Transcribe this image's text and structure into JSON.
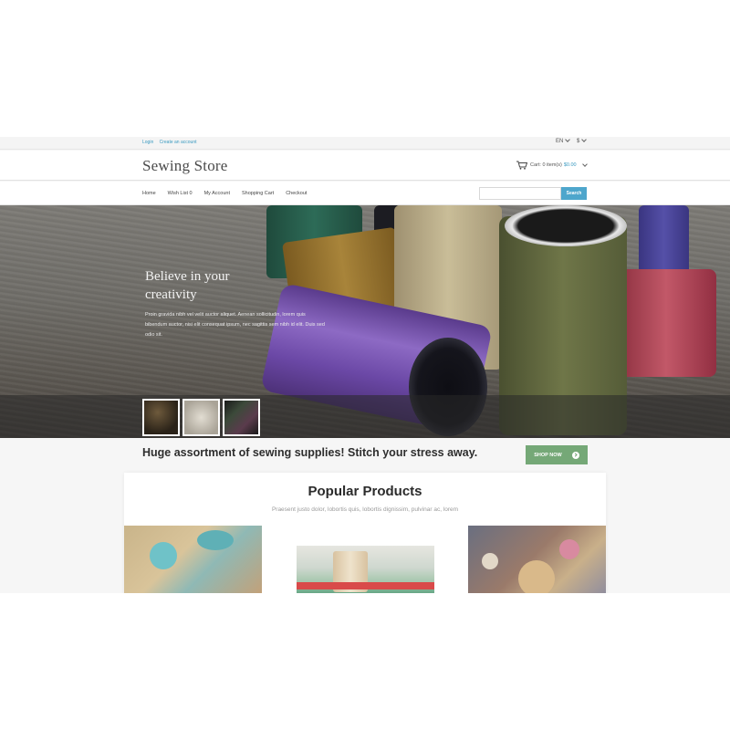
{
  "topbar": {
    "login": "Login",
    "create_account": "Create an account",
    "language": "EN",
    "currency": "$"
  },
  "header": {
    "logo": "Sewing Store",
    "cart_label": "Cart: 0 item(s)",
    "cart_price": "$0.00"
  },
  "nav": {
    "items": [
      "Home",
      "Wish List 0",
      "My Account",
      "Shopping Cart",
      "Checkout"
    ],
    "search_placeholder": "",
    "search_button": "Search"
  },
  "hero": {
    "title": "Believe in your creativity",
    "body": "Proin gravida nibh vel velit auctor aliquet. Aenean sollicitudin, lorem quis bibendum auctor, nisi elit consequat ipsum, nec sagittis sem nibh id elit. Duis sed odio sit."
  },
  "banner": {
    "text": "Huge assortment of sewing supplies! Stitch your stress away.",
    "button": "SHOP NOW"
  },
  "popular": {
    "title": "Popular Products",
    "subtitle": "Praesent justo dolor, lobortis quis, lobortis dignissim, pulvinar ac, lorem"
  },
  "colors": {
    "link_blue": "#3a9ac0",
    "search_blue": "#4ea6cc",
    "shop_green": "#75a877"
  }
}
